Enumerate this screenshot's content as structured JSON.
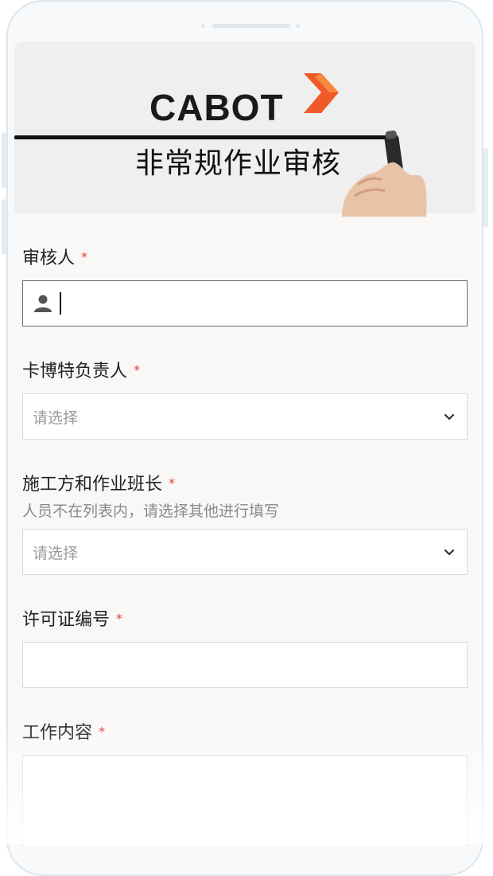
{
  "banner": {
    "logo_text": "CABOT",
    "title": "非常规作业审核",
    "logo_color": "#f05a28"
  },
  "form": {
    "reviewer": {
      "label": "审核人",
      "required_mark": "*",
      "icon": "user-icon",
      "value": ""
    },
    "cabot_owner": {
      "label": "卡博特负责人",
      "required_mark": "*",
      "placeholder": "请选择",
      "icon": "chevron-down-icon"
    },
    "contractor_leader": {
      "label": "施工方和作业班长",
      "required_mark": "*",
      "hint": "人员不在列表内，请选择其他进行填写",
      "placeholder": "请选择",
      "icon": "chevron-down-icon"
    },
    "permit_number": {
      "label": "许可证编号",
      "required_mark": "*",
      "value": ""
    },
    "work_content": {
      "label": "工作内容",
      "required_mark": "*",
      "value": ""
    }
  },
  "colors": {
    "required": "#e23b3b",
    "border": "#d9d9d9",
    "active_border": "#6a6a6a"
  }
}
